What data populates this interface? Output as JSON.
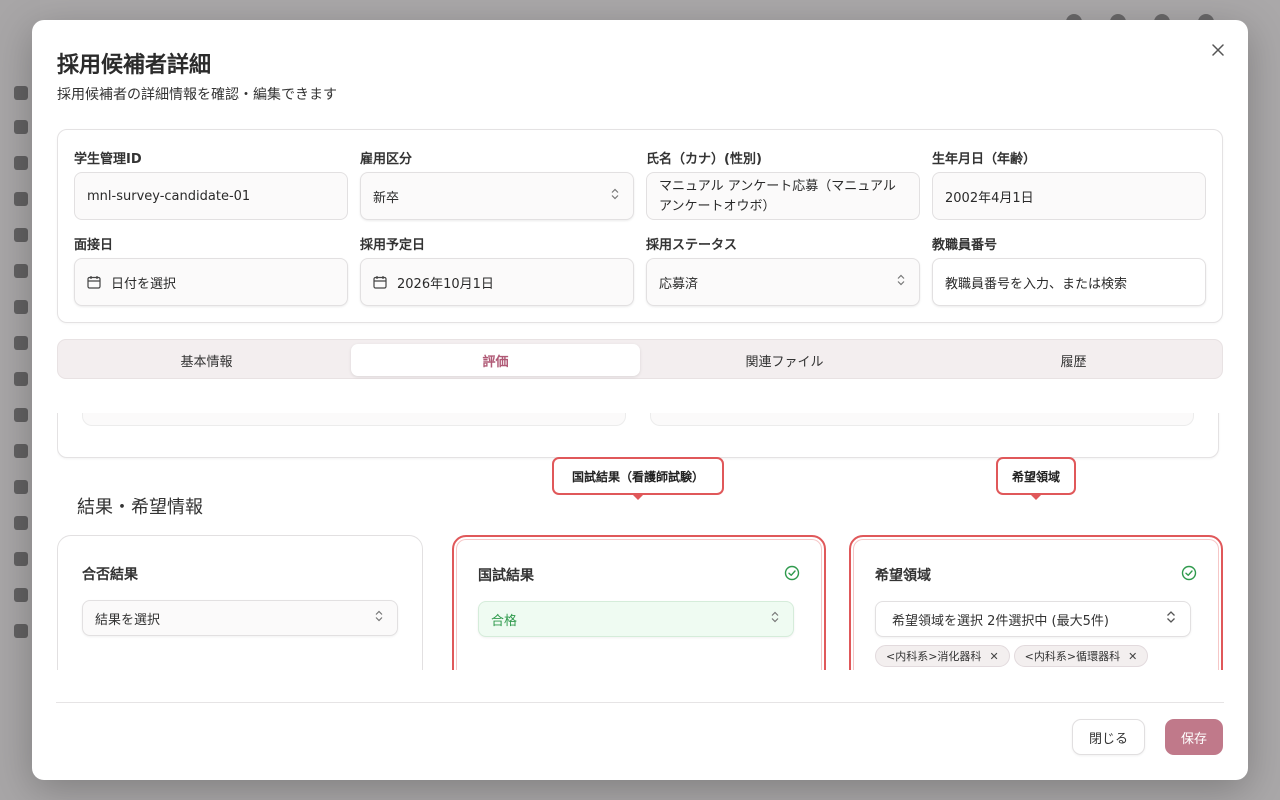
{
  "modal": {
    "title": "採用候補者詳細",
    "subtitle": "採用候補者の詳細情報を確認・編集できます"
  },
  "fields": {
    "student_id": {
      "label": "学生管理ID",
      "value": "mnl-survey-candidate-01"
    },
    "employment_type": {
      "label": "雇用区分",
      "value": "新卒"
    },
    "name": {
      "label": "氏名（カナ）(性別)",
      "value": "マニュアル アンケート応募（マニュアル アンケートオウボ）"
    },
    "birthdate": {
      "label": "生年月日（年齢）",
      "value": "2002年4月1日"
    },
    "interview_date": {
      "label": "面接日",
      "value": "日付を選択"
    },
    "planned_hire_date": {
      "label": "採用予定日",
      "value": "2026年10月1日"
    },
    "hiring_status": {
      "label": "採用ステータス",
      "value": "応募済"
    },
    "staff_number": {
      "label": "教職員番号",
      "placeholder": "教職員番号を入力、または検索"
    }
  },
  "tabs": [
    {
      "label": "基本情報",
      "active": false
    },
    {
      "label": "評価",
      "active": true
    },
    {
      "label": "関連ファイル",
      "active": false
    },
    {
      "label": "履歴",
      "active": false
    }
  ],
  "results": {
    "section_title": "結果・希望情報",
    "pass_result": {
      "title": "合否結果",
      "value": "結果を選択"
    },
    "national_exam": {
      "title": "国試結果",
      "value": "合格",
      "callout": "国試結果（看護師試験）"
    },
    "desired_field": {
      "title": "希望領域",
      "value": "希望領域を選択 2件選択中 (最大5件)",
      "callout": "希望領域",
      "chips": [
        "<内科系>消化器科",
        "<内科系>循環器科"
      ]
    }
  },
  "footer": {
    "close_label": "閉じる",
    "save_label": "保存"
  },
  "colors": {
    "accent": "#c0798a",
    "active_tab_text": "#b05a76",
    "highlight": "#e0585a",
    "success": "#2f9a4d"
  }
}
